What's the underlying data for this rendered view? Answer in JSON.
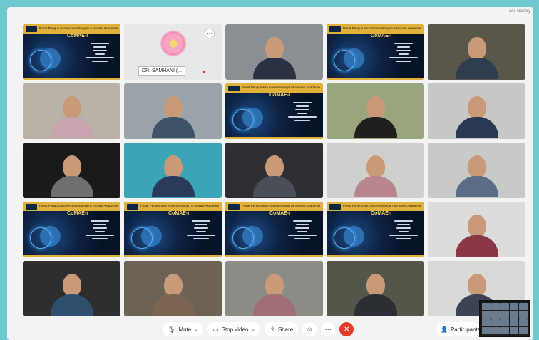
{
  "window": {
    "label": "cas Gallery"
  },
  "event_banner": {
    "title": "Pusat Pengurusan Kecemerlangan & Inovasi Akademik",
    "subtitle": "CoMAE-i"
  },
  "participant_tiles": [
    {
      "kind": "banner"
    },
    {
      "kind": "avatar",
      "name": "DR. SAMHANI (..."
    },
    {
      "kind": "video",
      "bg": "#8b8f93",
      "shirt": "#2a3142"
    },
    {
      "kind": "banner"
    },
    {
      "kind": "video",
      "bg": "#59564a",
      "shirt": "#2f3d4f"
    },
    {
      "kind": "video",
      "bg": "#b8b3a6",
      "shirt": "#c7a4b0"
    },
    {
      "kind": "video",
      "bg": "#9aa3a8",
      "shirt": "#3e5368"
    },
    {
      "kind": "banner"
    },
    {
      "kind": "video",
      "bg": "#98a57d",
      "shirt": "#1f1f1f"
    },
    {
      "kind": "video",
      "bg": "#c7c7c5",
      "shirt": "#2b3952"
    },
    {
      "kind": "video",
      "bg": "#1a1a1a",
      "shirt": "#6f6f70"
    },
    {
      "kind": "video",
      "bg": "#3aa6b5",
      "shirt": "#2a3a5a"
    },
    {
      "kind": "video",
      "bg": "#2f2f33",
      "shirt": "#4a4f57"
    },
    {
      "kind": "video",
      "bg": "#cfcfcd",
      "shirt": "#b9868e"
    },
    {
      "kind": "video",
      "bg": "#c9c9c7",
      "shirt": "#5b6d86"
    },
    {
      "kind": "banner"
    },
    {
      "kind": "banner"
    },
    {
      "kind": "banner"
    },
    {
      "kind": "banner"
    },
    {
      "kind": "video",
      "bg": "#dcdcdc",
      "shirt": "#8a3848"
    },
    {
      "kind": "video",
      "bg": "#2e2e2e",
      "shirt": "#2e4f6e"
    },
    {
      "kind": "video",
      "bg": "#6d6256",
      "shirt": "#7c6550"
    },
    {
      "kind": "video",
      "bg": "#8c8c86",
      "shirt": "#a06f76"
    },
    {
      "kind": "video",
      "bg": "#54564a",
      "shirt": "#2b2f33"
    },
    {
      "kind": "video",
      "bg": "#d9d9d7",
      "shirt": "#3b4354"
    }
  ],
  "toolbar": {
    "mute_label": "Mute",
    "stop_video_label": "Stop video",
    "share_label": "Share",
    "participants_label": "Participants"
  },
  "icons": {
    "mic": "microphone-icon",
    "video": "video-camera-icon",
    "share": "share-icon",
    "reactions": "emoji-icon",
    "more": "more-icon",
    "end": "close-icon",
    "participants": "participants-icon"
  },
  "colors": {
    "end_call": "#e43b2c",
    "banner_gold": "#e2b13a",
    "background": "#6ec9cf"
  }
}
